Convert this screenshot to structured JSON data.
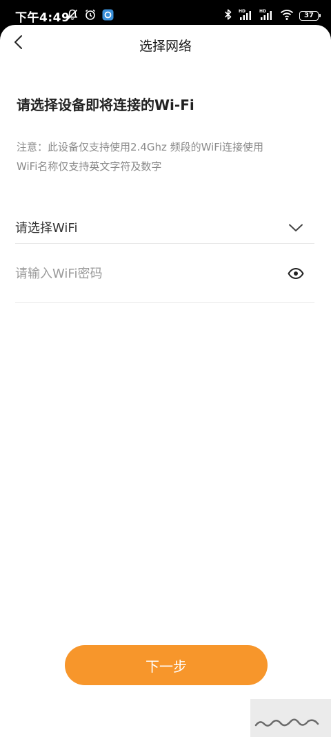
{
  "status_bar": {
    "time": "下午4:49",
    "battery_level": "37",
    "left_icons": [
      "bell-off-icon",
      "alarm-icon",
      "app-notification-icon"
    ],
    "right_icons": [
      "bluetooth-icon",
      "signal-hd-icon",
      "signal-hd-icon",
      "wifi-icon",
      "battery-icon"
    ]
  },
  "nav": {
    "title": "选择网络",
    "back_icon": "chevron-left-icon"
  },
  "content": {
    "heading": "请选择设备即将连接的Wi-Fi",
    "notice_line1": "注意：此设备仅支持使用2.4Ghz 频段的WiFi连接使用",
    "notice_line2": "WiFi名称仅支持英文字符及数字"
  },
  "wifi_select": {
    "label": "请选择WiFi",
    "icon": "chevron-down-icon"
  },
  "password": {
    "placeholder": "请输入WiFi密码",
    "value": "",
    "icon": "eye-icon"
  },
  "actions": {
    "next_label": "下一步"
  },
  "colors": {
    "accent": "#f7962b",
    "heading": "#222222",
    "notice": "#8a8a8a",
    "divider": "#e8e8e8"
  }
}
